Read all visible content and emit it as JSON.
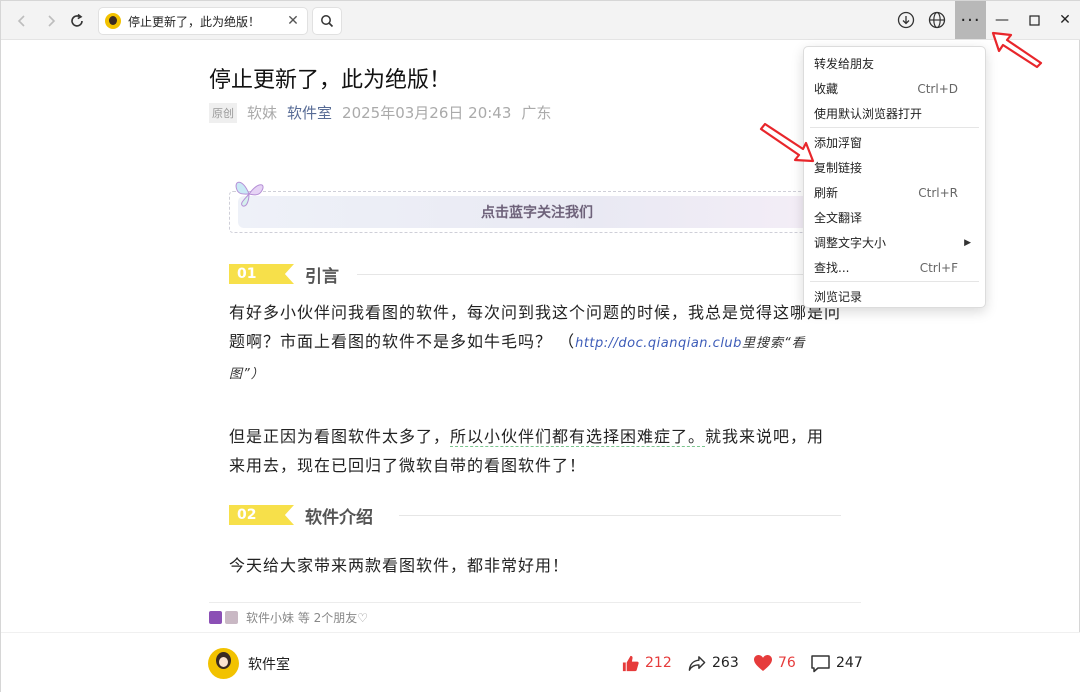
{
  "browser": {
    "tab_title": "停止更新了，此为绝版！",
    "tab_close_symbol": "✕",
    "nav": {
      "back_icon": "back-arrow-icon",
      "forward_icon": "forward-arrow-icon",
      "reload_icon": "reload-icon"
    },
    "toolbar": {
      "more_symbol": "···"
    },
    "window_controls": {
      "minimize": "—",
      "maximize": "☐",
      "close": "✕"
    }
  },
  "article": {
    "title": "停止更新了，此为绝版！",
    "original_badge": "原创",
    "author": "软妹",
    "account": "软件室",
    "date": "2025年03月26日 20:43",
    "location": "广东",
    "follow_banner": "点击蓝字关注我们",
    "sections": [
      {
        "num": "01",
        "title": "引言"
      },
      {
        "num": "02",
        "title": "软件介绍"
      }
    ],
    "para1": {
      "text": "有好多小伙伴问我看图的软件，每次问到我这个问题的时候，我总是觉得这哪是问题啊？市面上看图的软件不是多如牛毛吗？ （",
      "link": "http://doc.qianqian.club",
      "note": "里搜索“看图”",
      "close": "）"
    },
    "para2": {
      "part_a": "但是正因为看图软件太多了，",
      "part_b": "所以小伙伴们都有选择困难症了。",
      "part_c": "就我来说吧，用来用去，现在已回归了微软自带的看图软件了！"
    },
    "para3": "今天给大家带来两款看图软件，都非常好用！",
    "friends_line": "软件小妹 等  2个朋友♡"
  },
  "footer": {
    "account_name": "软件室",
    "likes": "212",
    "shares": "263",
    "hearts": "76",
    "comments": "247"
  },
  "context_menu": {
    "items": [
      {
        "label": "转发给朋友",
        "shortcut": ""
      },
      {
        "label": "收藏",
        "shortcut": "Ctrl+D"
      },
      {
        "label": "使用默认浏览器打开",
        "shortcut": ""
      },
      {
        "label": "添加浮窗",
        "shortcut": ""
      },
      {
        "label": "复制链接",
        "shortcut": ""
      },
      {
        "label": "刷新",
        "shortcut": "Ctrl+R"
      },
      {
        "label": "全文翻译",
        "shortcut": ""
      },
      {
        "label": "调整文字大小",
        "shortcut": "",
        "submenu": true
      },
      {
        "label": "查找...",
        "shortcut": "Ctrl+F"
      },
      {
        "label": "浏览记录",
        "shortcut": ""
      }
    ]
  },
  "colors": {
    "accent_yellow": "#f7e04a",
    "link_blue": "#576b95",
    "like_red": "#e63b3b",
    "annotation_red": "#e8262b"
  }
}
